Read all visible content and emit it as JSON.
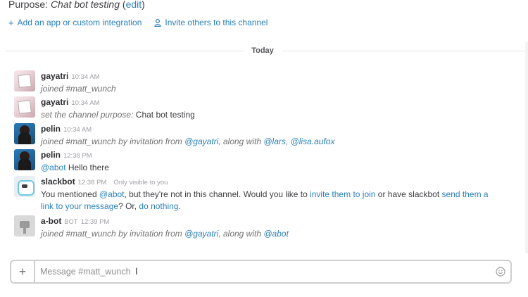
{
  "header": {
    "purpose_prefix": "Purpose: ",
    "purpose_value": "Chat bot testing",
    "purpose_open": " (",
    "edit_label": "edit",
    "purpose_close": ")"
  },
  "actions": {
    "add_app_label": "Add an app or custom integration",
    "invite_label": "Invite others to this channel"
  },
  "divider": {
    "label": "Today"
  },
  "messages": [
    {
      "sender": "gayatri",
      "time": "10:34 AM",
      "text": "joined #matt_wunch"
    },
    {
      "sender": "gayatri",
      "time": "10:34 AM",
      "text_italic": "set the channel purpose:",
      "text_plain": " Chat bot testing"
    },
    {
      "sender": "pelin",
      "time": "10:34 AM",
      "text_prefix": "joined #matt_wunch by invitation from ",
      "mention_1": "@gayatri",
      "text_mid": ", along with ",
      "mention_2": "@lars",
      "text_sep": ", ",
      "mention_3": "@lisa.aufox"
    },
    {
      "sender": "pelin",
      "time": "12:38 PM",
      "mention": "@abot",
      "text": " Hello there"
    },
    {
      "sender": "slackbot",
      "time": "12:38 PM",
      "visibility": "Only visible to you",
      "line1_a": "You mentioned ",
      "line1_mention": "@abot",
      "line1_b": ", but they're not in this channel. Would you like to ",
      "line1_link1": "invite them to join",
      "line1_c": " or have slackbot ",
      "line1_link2a": "send them a",
      "line2_link2b": "link to your message",
      "line2_a": "? Or, ",
      "line2_link3": "do nothing",
      "line2_b": "."
    },
    {
      "sender": "a-bot",
      "bot_tag": "BOT",
      "time": "12:39 PM",
      "text_prefix": "joined #matt_wunch by invitation from ",
      "mention_1": "@gayatri",
      "text_mid": ", along with ",
      "mention_2": "@abot"
    }
  ],
  "composer": {
    "plus_glyph": "+",
    "placeholder": "Message #matt_wunch",
    "cursor_glyph": "I"
  },
  "icons": {
    "plus": "plus-icon",
    "person": "person-icon",
    "emoji": "smiley-emoji-icon",
    "cursor": "text-cursor-icon"
  },
  "colors": {
    "link": "#2a80b9",
    "timestamp": "#9e9ea6",
    "border": "#cfcfd2"
  }
}
